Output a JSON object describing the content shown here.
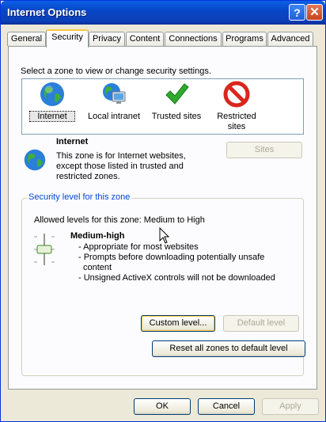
{
  "window": {
    "title": "Internet Options",
    "help_glyph": "?",
    "close_glyph": "✕"
  },
  "tabs": [
    "General",
    "Security",
    "Privacy",
    "Content",
    "Connections",
    "Programs",
    "Advanced"
  ],
  "active_tab": "Security",
  "security": {
    "select_zone_text": "Select a zone to view or change security settings.",
    "zones": [
      {
        "label": "Internet",
        "icon": "globe-icon"
      },
      {
        "label": "Local intranet",
        "icon": "intranet-globe-monitor-icon"
      },
      {
        "label": "Trusted sites",
        "icon": "checkmark-icon"
      },
      {
        "label": "Restricted sites",
        "icon": "no-entry-icon"
      }
    ],
    "selected_zone": "Internet",
    "zone_info": {
      "title": "Internet",
      "description": "This zone is for Internet websites, except those listed in trusted and restricted zones.",
      "desc_line1": "This zone is for Internet websites,",
      "desc_line2": "except those listed in trusted and",
      "desc_line3": "restricted zones."
    },
    "sites_button": "Sites",
    "level_group": {
      "label": "Security level for this zone",
      "allowed": "Allowed levels for this zone: Medium to High",
      "level_name": "Medium-high",
      "bullets": [
        "- Appropriate for most websites",
        "- Prompts before downloading potentially unsafe",
        "  content",
        "- Unsigned ActiveX controls will not be downloaded"
      ],
      "custom_level_button": "Custom level...",
      "default_level_button": "Default level"
    },
    "reset_all_button": "Reset all zones to default level"
  },
  "footer": {
    "ok": "OK",
    "cancel": "Cancel",
    "apply": "Apply"
  },
  "colors": {
    "title_bar": "#0a5fe6",
    "dialog_bg": "#ece9d8",
    "panel_bg": "#fcfcfe",
    "group_label": "#0046d5",
    "active_tab_accent": "#ffc83c"
  }
}
